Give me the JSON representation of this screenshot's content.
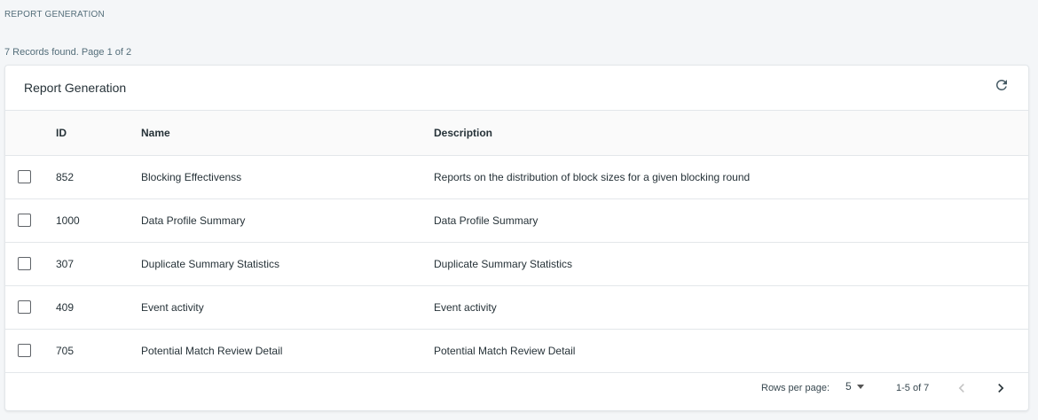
{
  "page": {
    "heading": "REPORT GENERATION",
    "records_status": "7 Records found. Page 1 of 2"
  },
  "card": {
    "title": "Report Generation",
    "refresh_icon": "refresh-icon"
  },
  "table": {
    "columns": [
      "ID",
      "Name",
      "Description"
    ],
    "rows": [
      {
        "id": "852",
        "name": "Blocking Effectivenss",
        "description": "Reports on the distribution of block sizes for a given blocking round"
      },
      {
        "id": "1000",
        "name": "Data Profile Summary",
        "description": "Data Profile Summary"
      },
      {
        "id": "307",
        "name": "Duplicate Summary Statistics",
        "description": "Duplicate Summary Statistics"
      },
      {
        "id": "409",
        "name": "Event activity",
        "description": "Event activity"
      },
      {
        "id": "705",
        "name": "Potential Match Review Detail",
        "description": "Potential Match Review Detail"
      }
    ]
  },
  "pagination": {
    "rows_per_page_label": "Rows per page:",
    "rows_per_page_value": "5",
    "range": "1-5 of 7",
    "prev_icon": "chevron-left-icon",
    "next_icon": "chevron-right-icon",
    "prev_disabled_color": "#c4c4c4",
    "next_color": "#263238"
  }
}
